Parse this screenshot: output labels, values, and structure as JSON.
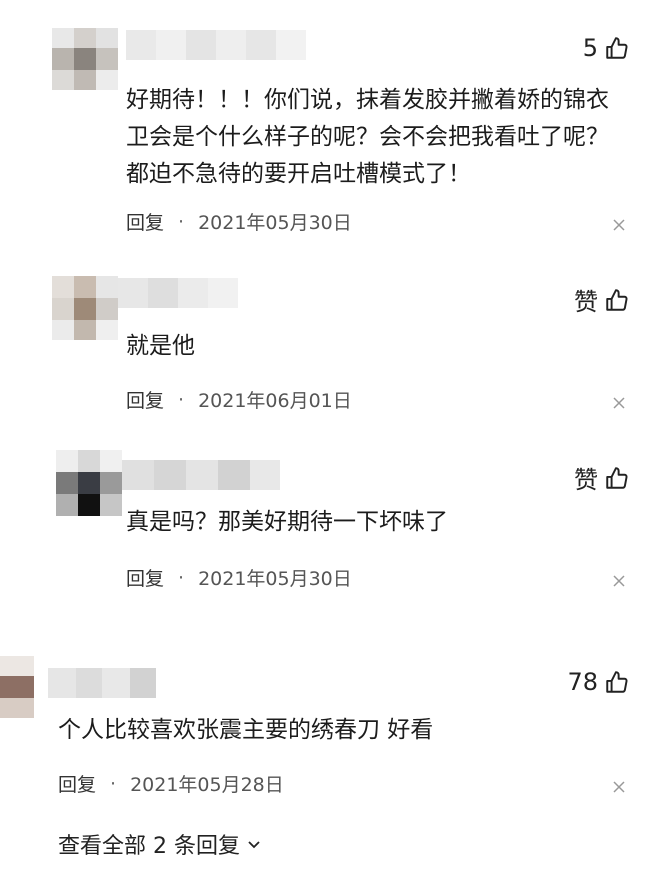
{
  "comments": [
    {
      "likes": "5",
      "text": "好期待！！！你们说，抹着发胶并撇着娇的锦衣卫会是个什么样子的呢？会不会把我看吐了呢？都迫不急待的要开启吐槽模式了！",
      "reply": "回复",
      "date": "2021年05月30日"
    },
    {
      "likes": "赞",
      "text": "就是他",
      "reply": "回复",
      "date": "2021年06月01日"
    },
    {
      "likes": "赞",
      "text": "真是吗？那美好期待一下坏味了",
      "reply": "回复",
      "date": "2021年05月30日"
    },
    {
      "likes": "78",
      "text": "个人比较喜欢张震主要的绣春刀 好看",
      "reply": "回复",
      "date": "2021年05月28日"
    }
  ],
  "view_all": "查看全部 2 条回复",
  "icons": {
    "like": "thumbs-up-icon",
    "close": "close-icon",
    "expand": "chevron-down-icon"
  }
}
